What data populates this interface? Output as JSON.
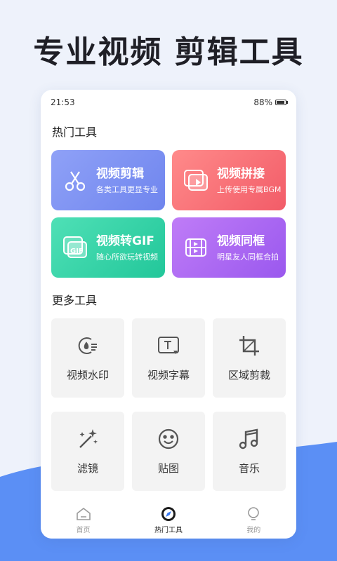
{
  "headline": "专业视频 剪辑工具",
  "status_bar": {
    "time": "21:53",
    "battery": "88%"
  },
  "hot_tools": {
    "title": "热门工具",
    "items": [
      {
        "title": "视频剪辑",
        "subtitle": "各类工具更显专业",
        "icon": "scissors-icon",
        "color": "#7b8ff2"
      },
      {
        "title": "视频拼接",
        "subtitle": "上传使用专属BGM",
        "icon": "video-stack-icon",
        "color": "#f66d76"
      },
      {
        "title": "视频转GIF",
        "subtitle": "随心所欲玩转视频",
        "icon": "gif-icon",
        "color": "#2fd2a5"
      },
      {
        "title": "视频同框",
        "subtitle": "明星友人同框合拍",
        "icon": "film-frame-icon",
        "color": "#a963f2"
      }
    ]
  },
  "more_tools": {
    "title": "更多工具",
    "items": [
      {
        "label": "视频水印",
        "icon": "watermark-icon"
      },
      {
        "label": "视频字幕",
        "icon": "subtitle-icon"
      },
      {
        "label": "区域剪裁",
        "icon": "crop-icon"
      },
      {
        "label": "滤镜",
        "icon": "magic-wand-icon"
      },
      {
        "label": "贴图",
        "icon": "smiley-sticker-icon"
      },
      {
        "label": "音乐",
        "icon": "music-note-icon"
      }
    ]
  },
  "tab_bar": {
    "items": [
      {
        "label": "首页",
        "icon": "home-icon",
        "active": false
      },
      {
        "label": "热门工具",
        "icon": "compass-icon",
        "active": true
      },
      {
        "label": "我的",
        "icon": "bulb-icon",
        "active": false
      }
    ]
  }
}
